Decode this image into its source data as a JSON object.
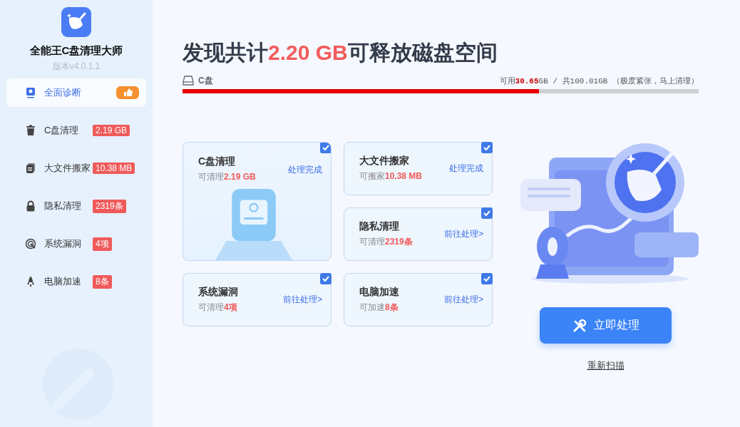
{
  "app": {
    "title": "全能王C盘清理大师",
    "version": "版本v4.0.1.1"
  },
  "nav": [
    {
      "label": "全面诊断",
      "recommended": true,
      "selected": true
    },
    {
      "label": "C盘清理",
      "badge": "2.19 GB",
      "recommended": false,
      "selected": false
    },
    {
      "label": "大文件搬家",
      "badge": "10.38 MB",
      "recommended": false,
      "selected": false
    },
    {
      "label": "隐私清理",
      "badge": "2319条",
      "recommended": false,
      "selected": false
    },
    {
      "label": "系统漏洞",
      "badge": "4项",
      "recommended": false,
      "selected": false
    },
    {
      "label": "电脑加速",
      "badge": "8条",
      "recommended": false,
      "selected": false
    }
  ],
  "headline": {
    "prefix": "发现共计",
    "amount": "2.20 GB",
    "suffix": "可释放磁盘空间"
  },
  "disk": {
    "label": "C盘",
    "free_label": "可用",
    "free": "30.65",
    "total": "GB / 共100.01GB",
    "status": "（极度紧张，马上清理）",
    "level": 0.69
  },
  "cards": [
    {
      "kind": "large",
      "title": "C盘清理",
      "sub_label": "可清理",
      "sub_value": "2.19 GB",
      "action": "处理完成",
      "checked": true
    },
    {
      "kind": "small",
      "title": "大文件搬家",
      "sub_label": "可搬家",
      "sub_value": "10.38 MB",
      "action": "处理完成",
      "checked": true
    },
    {
      "kind": "small",
      "title": "隐私清理",
      "sub_label": "可清理",
      "sub_value": "2319条",
      "action": "前往处理>",
      "checked": true
    },
    {
      "kind": "small",
      "title": "系统漏洞",
      "sub_label": "可清理",
      "sub_value": "4项",
      "action": "前往处理>",
      "checked": true
    },
    {
      "kind": "small",
      "title": "电脑加速",
      "sub_label": "可加速",
      "sub_value": "8条",
      "action": "前往处理>",
      "checked": true
    }
  ],
  "primary_button": "立即处理",
  "rescan_link": "重新扫描"
}
